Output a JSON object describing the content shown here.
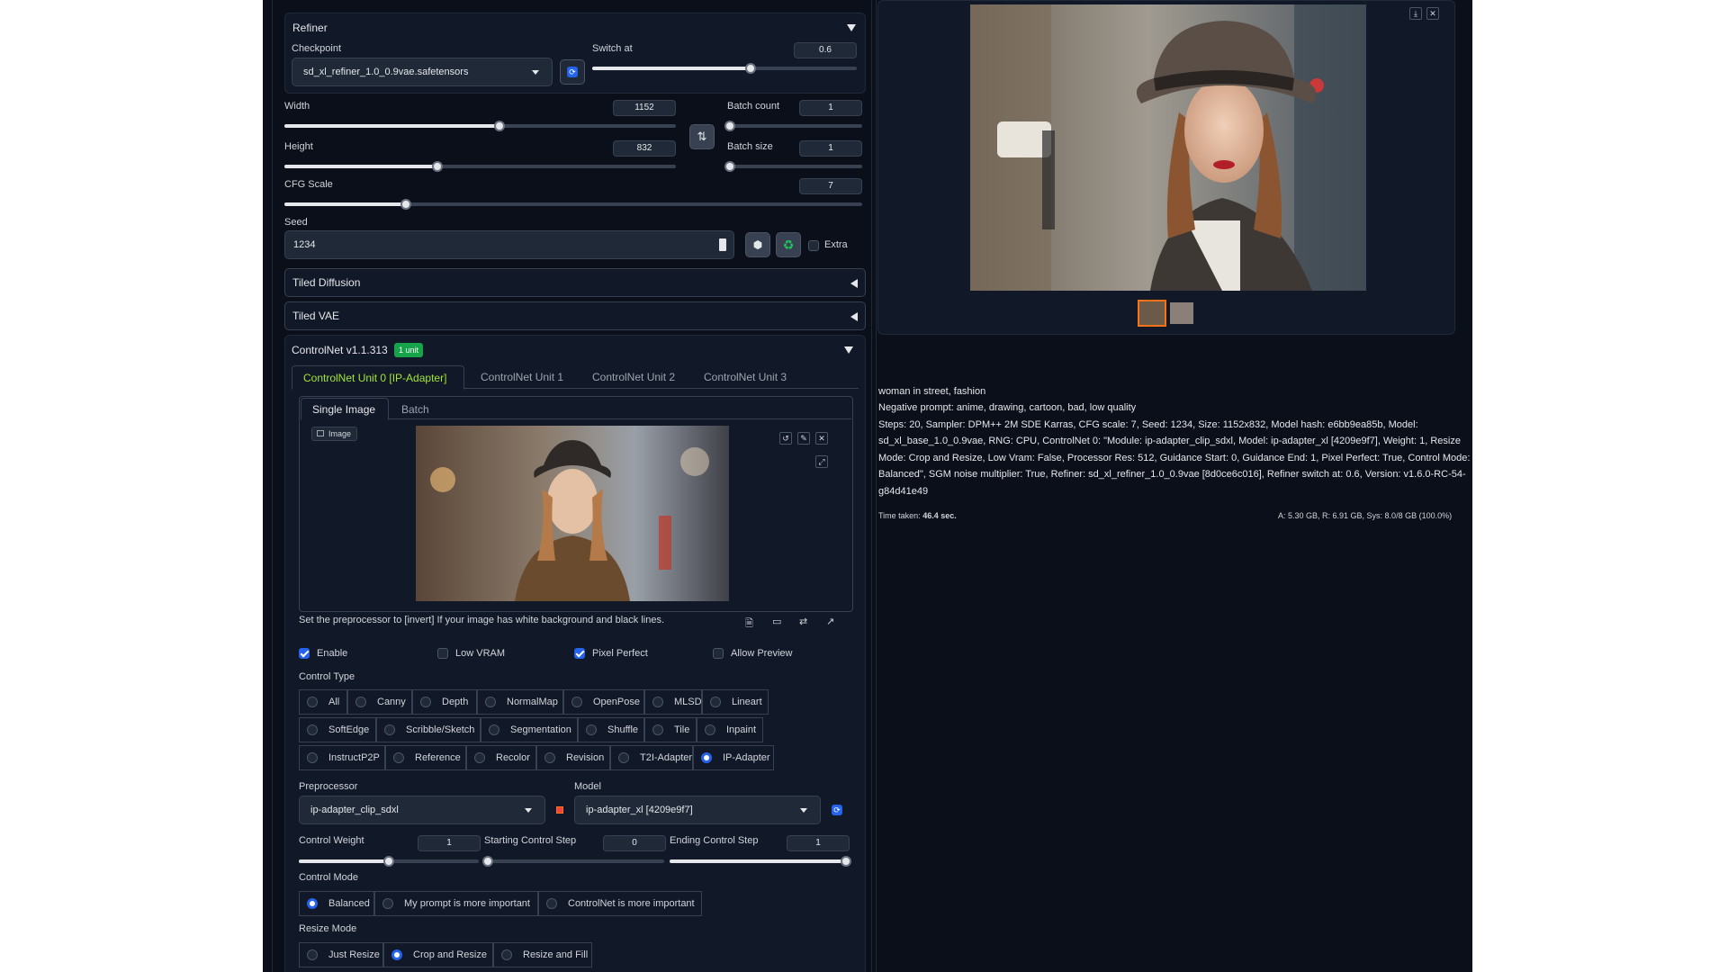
{
  "refiner": {
    "title": "Refiner",
    "checkpoint_label": "Checkpoint",
    "checkpoint_value": "sd_xl_refiner_1.0_0.9vae.safetensors",
    "switch_label": "Switch at",
    "switch_value": "0.6",
    "switch_fraction": 0.6
  },
  "size": {
    "width_label": "Width",
    "width_value": "1152",
    "height_label": "Height",
    "height_value": "832",
    "batch_count_label": "Batch count",
    "batch_count_value": "1",
    "batch_size_label": "Batch size",
    "batch_size_value": "1",
    "cfg_label": "CFG Scale",
    "cfg_value": "7"
  },
  "seed": {
    "label": "Seed",
    "value": "1234",
    "extra_label": "Extra"
  },
  "accordions": {
    "tiled_diffusion": "Tiled Diffusion",
    "tiled_vae": "Tiled VAE"
  },
  "controlnet": {
    "title": "ControlNet v1.1.313",
    "badge": "1 unit",
    "tabs": [
      "ControlNet Unit 0 [IP-Adapter]",
      "ControlNet Unit 1",
      "ControlNet Unit 2",
      "ControlNet Unit 3"
    ],
    "image_tabs": [
      "Single Image",
      "Batch"
    ],
    "image_label": "Image",
    "hint": "Set the preprocessor to [invert] If your image has white background and black lines.",
    "enable_label": "Enable",
    "low_vram_label": "Low VRAM",
    "pixel_perfect_label": "Pixel Perfect",
    "allow_preview_label": "Allow Preview",
    "control_type_label": "Control Type",
    "control_types_row1": [
      "All",
      "Canny",
      "Depth",
      "NormalMap",
      "OpenPose",
      "MLSD",
      "Lineart"
    ],
    "control_types_row2": [
      "SoftEdge",
      "Scribble/Sketch",
      "Segmentation",
      "Shuffle",
      "Tile",
      "Inpaint"
    ],
    "control_types_row3": [
      "InstructP2P",
      "Reference",
      "Recolor",
      "Revision",
      "T2I-Adapter",
      "IP-Adapter"
    ],
    "preprocessor_label": "Preprocessor",
    "preprocessor_value": "ip-adapter_clip_sdxl",
    "model_label": "Model",
    "model_value": "ip-adapter_xl [4209e9f7]",
    "weight_label": "Control Weight",
    "weight_value": "1",
    "start_label": "Starting Control Step",
    "start_value": "0",
    "end_label": "Ending Control Step",
    "end_value": "1",
    "control_mode_label": "Control Mode",
    "control_modes": [
      "Balanced",
      "My prompt is more important",
      "ControlNet is more important"
    ],
    "resize_mode_label": "Resize Mode",
    "resize_modes": [
      "Just Resize",
      "Crop and Resize",
      "Resize and Fill"
    ]
  },
  "output": {
    "prompt": "woman in street, fashion",
    "negative": "Negative prompt: anime, drawing, cartoon, bad, low quality",
    "params_lines": [
      "Steps: 20, Sampler: DPM++ 2M SDE Karras, CFG scale: 7, Seed: 1234, Size: 1152x832, Model hash: e6bb9ea85b, Model:",
      "sd_xl_base_1.0_0.9vae, RNG: CPU, ControlNet 0: \"Module: ip-adapter_clip_sdxl, Model: ip-adapter_xl [4209e9f7], Weight: 1, Resize",
      "Mode: Crop and Resize, Low Vram: False, Processor Res: 512, Guidance Start: 0, Guidance End: 1, Pixel Perfect: True, Control Mode:",
      "Balanced\", SGM noise multiplier: True, Refiner: sd_xl_refiner_1.0_0.9vae [8d0ce6c016], Refiner switch at: 0.6, Version: v1.6.0-RC-54-",
      "g84d41e49"
    ],
    "time_label": "Time taken:",
    "time_value": "46.4 sec.",
    "vram_stats": "A: 5.30 GB, R: 6.91 GB, Sys: 8.0/8 GB (100.0%)"
  },
  "icons": {
    "refresh": "refresh-icon",
    "swap": "swap-dimensions-icon",
    "dice": "dice-icon",
    "recycle": "recycle-icon",
    "folder": "folder-icon",
    "save": "save-icon",
    "zip": "zip-icon",
    "image": "send-to-img2img-icon",
    "palette": "send-to-inpaint-icon",
    "ruler": "send-to-extras-icon"
  },
  "colors": {
    "background": "#0b0f19",
    "accent_blue": "#2563eb",
    "badge_green": "#16a34a",
    "active_tab": "#a3e635",
    "selected_thumb": "#f97316"
  }
}
